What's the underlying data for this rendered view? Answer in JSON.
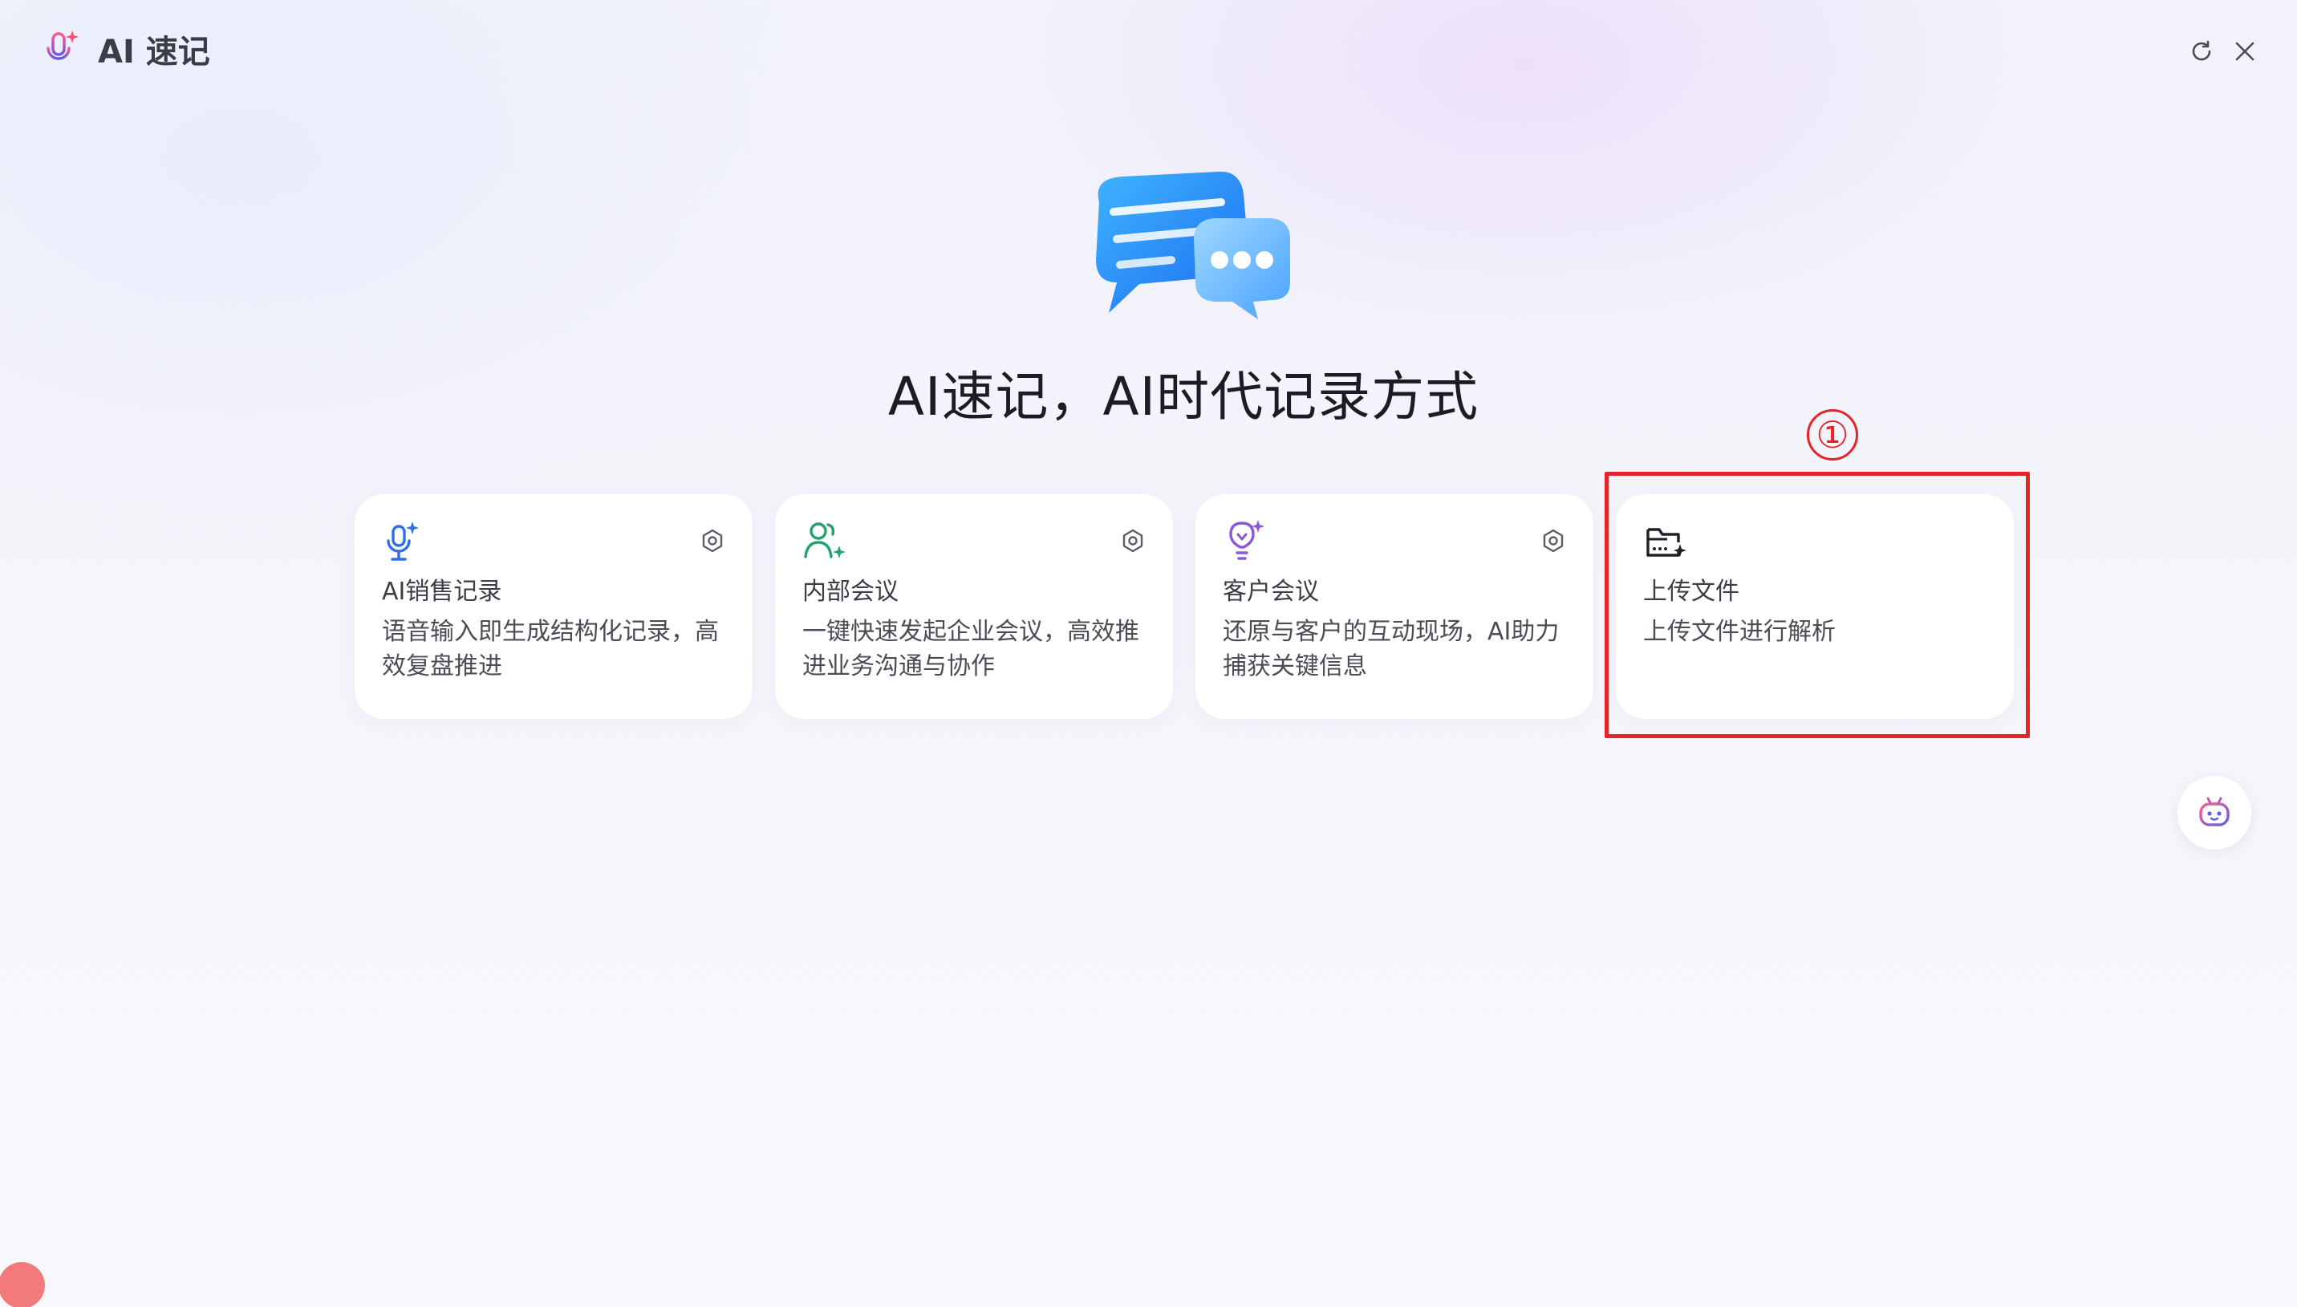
{
  "app": {
    "title": "AI 速记",
    "logo_icon": "mic-sparkle-icon"
  },
  "window_controls": {
    "refresh_icon": "refresh-icon",
    "close_icon": "close-icon"
  },
  "hero": {
    "illustration": "chat-bubbles-icon",
    "title": "AI速记，AI时代记录方式"
  },
  "cards": [
    {
      "title": "AI销售记录",
      "description": "语音输入即生成结构化记录，高效复盘推进",
      "icon": "mic-sparkle-icon",
      "icon_color": "#2f6fe6",
      "has_settings": true
    },
    {
      "title": "内部会议",
      "description": "一键快速发起企业会议，高效推进业务沟通与协作",
      "icon": "people-icon",
      "icon_color": "#23a36b",
      "has_settings": true
    },
    {
      "title": "客户会议",
      "description": "还原与客户的互动现场，AI助力捕获关键信息",
      "icon": "lightbulb-sparkle-icon",
      "icon_color": "#8a5ad6",
      "has_settings": true
    },
    {
      "title": "上传文件",
      "description": "上传文件进行解析",
      "icon": "folder-upload-icon",
      "icon_color": "#1e2027",
      "has_settings": false
    }
  ],
  "annotation": {
    "label": "①",
    "color": "#e3252a"
  },
  "assistant_button": {
    "icon": "robot-icon"
  },
  "colors": {
    "accent_blue": "#2f6fe6",
    "accent_green": "#23a36b",
    "accent_purple": "#8a5ad6",
    "annotation_red": "#e3252a",
    "record_dot": "#f27a7a"
  }
}
